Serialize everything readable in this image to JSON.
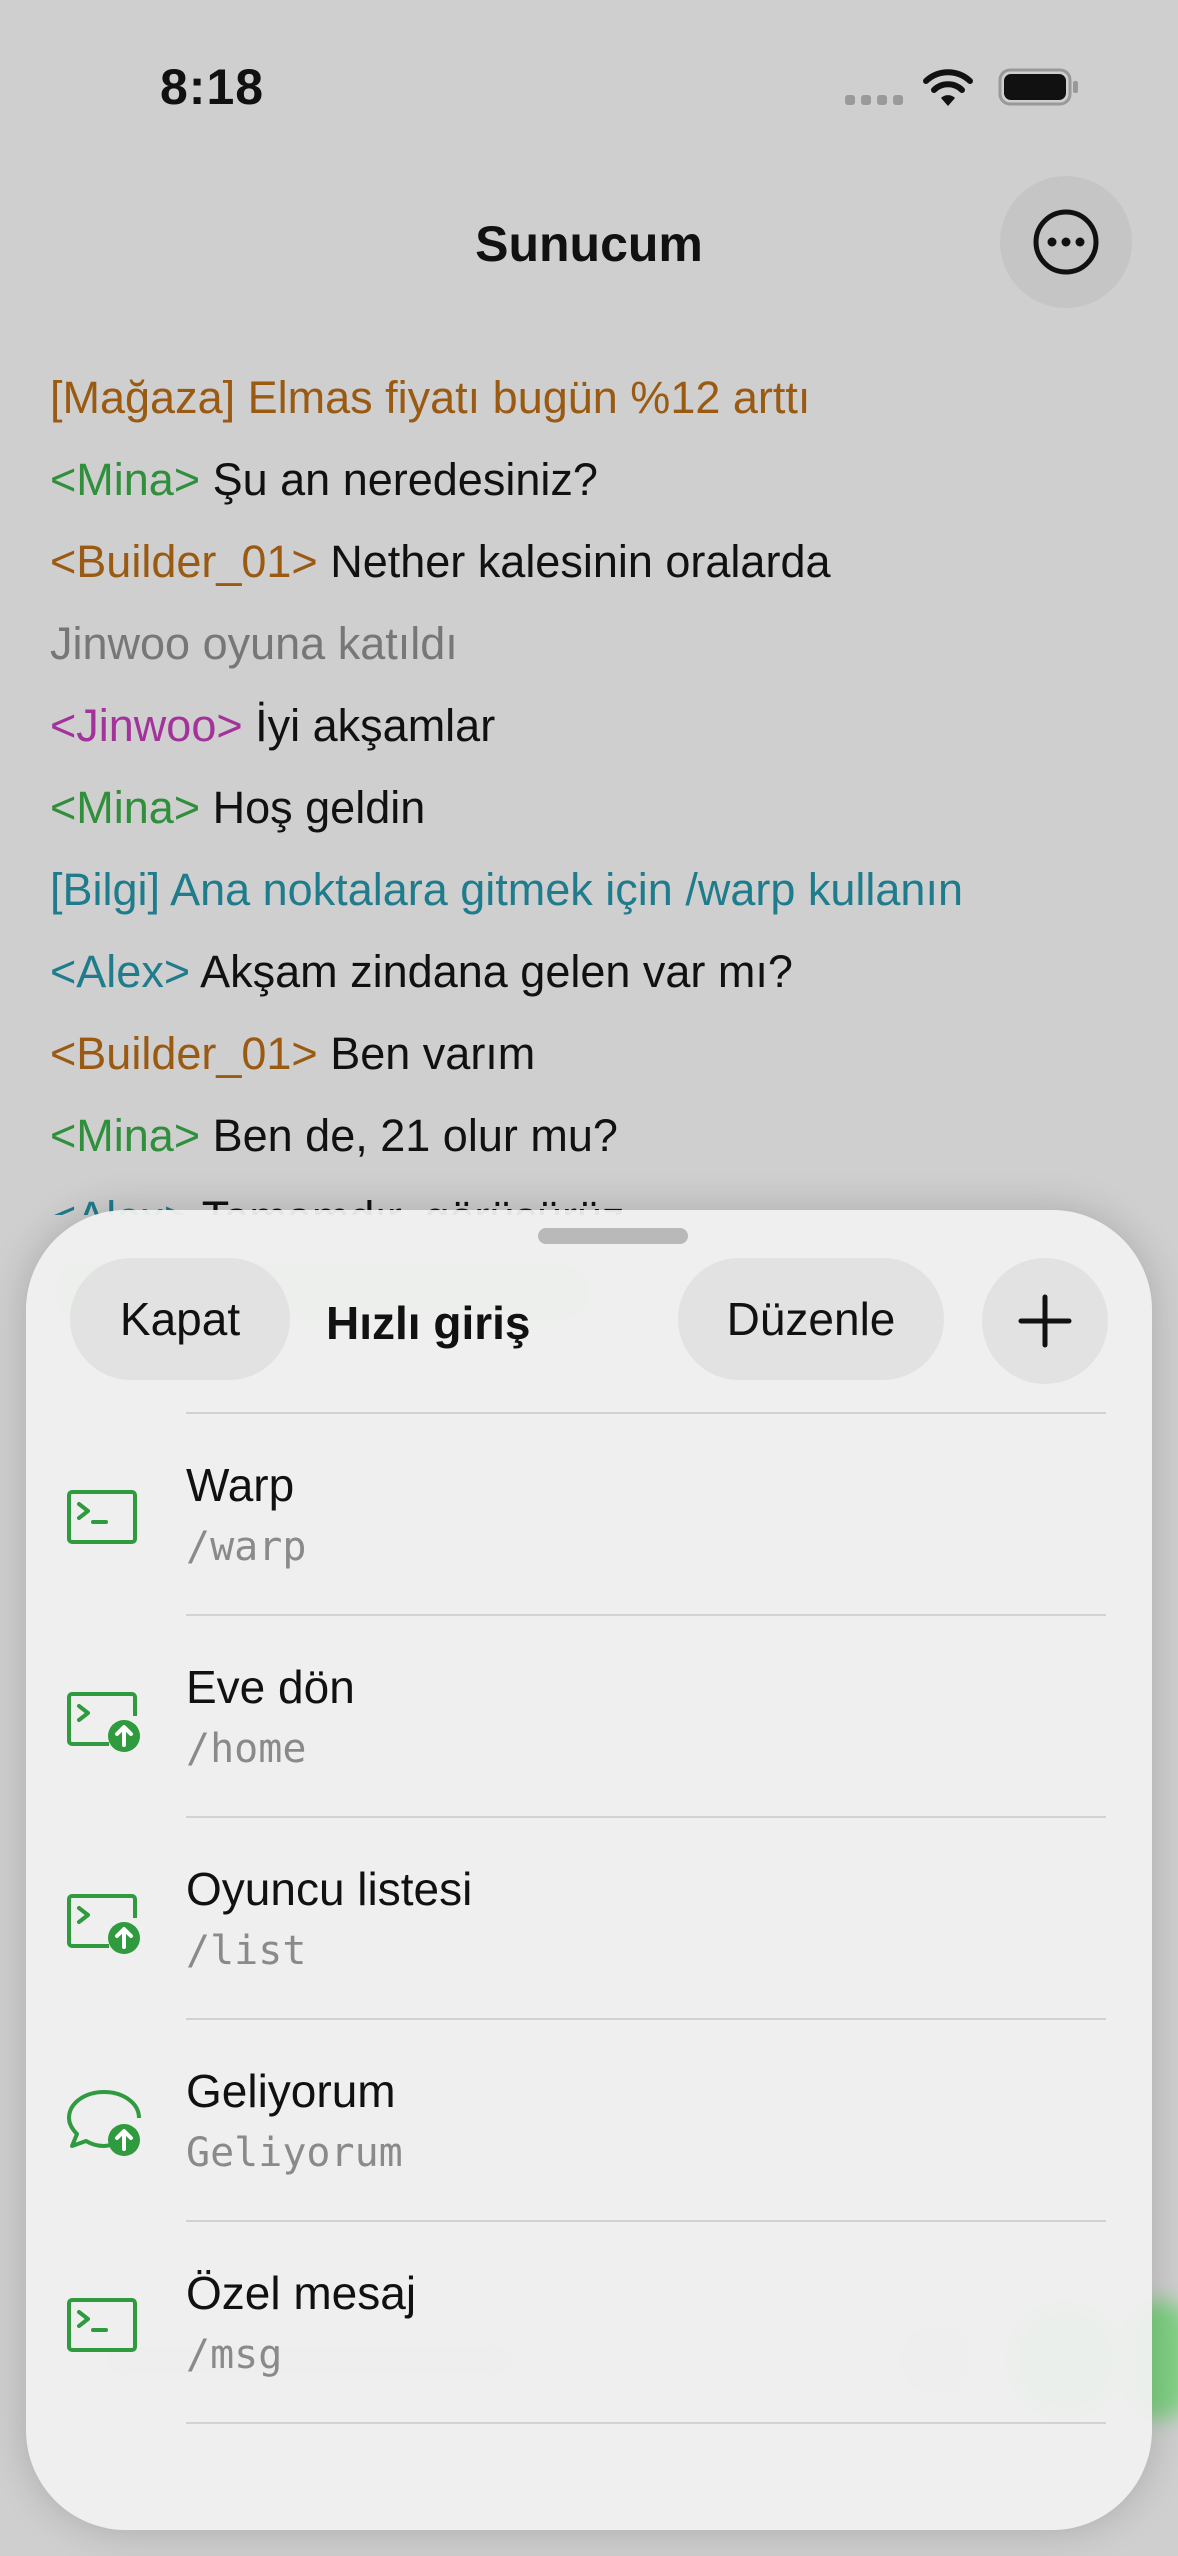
{
  "status_bar": {
    "time": "8:18"
  },
  "nav": {
    "title": "Sunucum"
  },
  "chat": [
    {
      "tag": "[Mağaza] ",
      "text": "Elmas fiyatı bugün %12 arttı",
      "tag_color": "#9a5a12",
      "text_color": "#9a5a12"
    },
    {
      "tag": "<Mina> ",
      "text": "Şu an neredesiniz?",
      "tag_color": "#2f8f3a",
      "text_color": "#111111"
    },
    {
      "tag": "<Builder_01> ",
      "text": "Nether kalesinin oralarda",
      "tag_color": "#9a5a12",
      "text_color": "#111111"
    },
    {
      "tag": "",
      "text": "Jinwoo oyuna katıldı",
      "tag_color": "#777777",
      "text_color": "#777777"
    },
    {
      "tag": "<Jinwoo> ",
      "text": "İyi akşamlar",
      "tag_color": "#a3339b",
      "text_color": "#111111"
    },
    {
      "tag": "<Mina> ",
      "text": "Hoş geldin",
      "tag_color": "#2f8f3a",
      "text_color": "#111111"
    },
    {
      "tag": "[Bilgi] ",
      "text": "Ana noktalara gitmek için /warp kullanın",
      "tag_color": "#1f7c8c",
      "text_color": "#1f7c8c"
    },
    {
      "tag": "<Alex> ",
      "text": "Akşam zindana gelen var mı?",
      "tag_color": "#1f7c8c",
      "text_color": "#111111"
    },
    {
      "tag": "<Builder_01> ",
      "text": "Ben varım",
      "tag_color": "#9a5a12",
      "text_color": "#111111"
    },
    {
      "tag": "<Mina> ",
      "text": "Ben de, 21 olur mu?",
      "tag_color": "#2f8f3a",
      "text_color": "#111111"
    },
    {
      "tag": "<Alex> ",
      "text": "Tamamdır, görüşürüz",
      "tag_color": "#1f7c8c",
      "text_color": "#111111"
    }
  ],
  "sheet": {
    "close_label": "Kapat",
    "title": "Hızlı giriş",
    "edit_label": "Düzenle",
    "items": [
      {
        "label": "Warp",
        "command": "/warp",
        "icon": "terminal-icon"
      },
      {
        "label": "Eve dön",
        "command": "/home",
        "icon": "terminal-send-icon"
      },
      {
        "label": "Oyuncu listesi",
        "command": "/list",
        "icon": "terminal-send-icon"
      },
      {
        "label": "Geliyorum",
        "command": "Geliyorum",
        "icon": "chat-send-icon"
      },
      {
        "label": "Özel mesaj",
        "command": "/msg",
        "icon": "terminal-icon"
      }
    ]
  },
  "colors": {
    "accent_green": "#2f9a3e"
  }
}
